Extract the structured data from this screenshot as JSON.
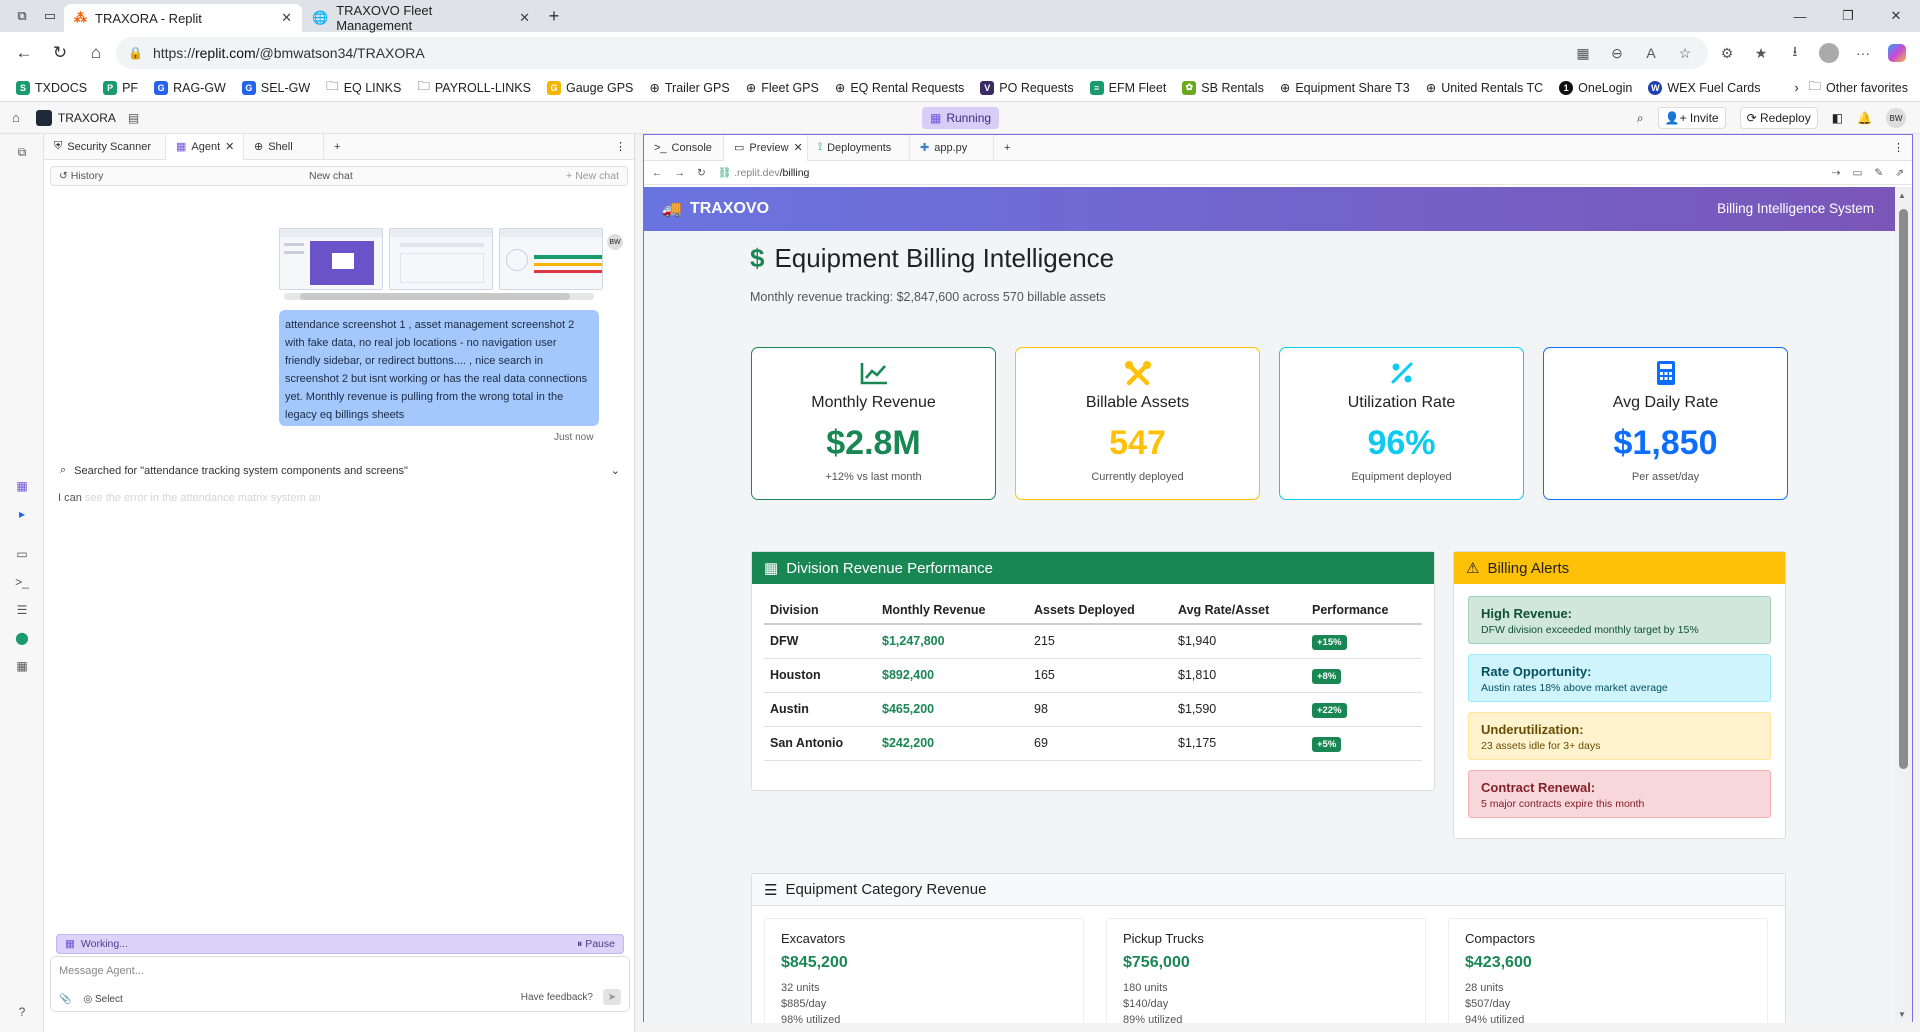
{
  "browser": {
    "tabs": [
      {
        "title": "TRAXORA - Replit",
        "active": true
      },
      {
        "title": "TRAXOVO Fleet Management",
        "active": false
      }
    ],
    "url_prefix": "https://",
    "url_host": "replit.com",
    "url_path": "/@bmwatson34/TRAXORA",
    "favorites": [
      "TXDOCS",
      "PF",
      "RAG-GW",
      "SEL-GW",
      "EQ LINKS",
      "PAYROLL-LINKS",
      "Gauge GPS",
      "Trailer GPS",
      "Fleet GPS",
      "EQ Rental Requests",
      "PO Requests",
      "EFM Fleet",
      "SB Rentals",
      "Equipment Share T3",
      "United Rentals TC",
      "OneLogin",
      "WEX Fuel Cards"
    ],
    "other_favorites": "Other favorites"
  },
  "replit": {
    "project": "TRAXORA",
    "status": "Running",
    "invite": "Invite",
    "redeploy": "Redeploy",
    "avatar": "BW",
    "left_tabs": [
      "Security Scanner",
      "Agent",
      "Shell"
    ],
    "history": "History",
    "new_chat_center": "New chat",
    "new_chat_right": "+ New chat",
    "message": "attendance screenshot 1 , asset management screenshot 2 with fake data, no real job locations - no navigation user friendly sidebar, or redirect buttons.... , nice search in screenshot 2 but isnt working or has the real data connections yet. Monthly revenue is pulling from the wrong total in the legacy eq billings sheets",
    "timestamp": "Just now",
    "searched": "Searched for \"attendance tracking system components and screens\"",
    "streaming_prefix": "I can",
    "streaming_faded": "see the error in the attendance matrix system an",
    "working": "Working...",
    "pause": "Pause",
    "message_placeholder": "Message Agent...",
    "select": "Select",
    "feedback": "Have feedback?",
    "right_tabs": [
      "Console",
      "Preview",
      "Deployments",
      "app.py"
    ],
    "preview_url_host": ".replit.dev",
    "preview_url_path": "/billing",
    "help": "?"
  },
  "app": {
    "brand": "TRAXOVO",
    "header_right": "Billing Intelligence System",
    "title": "Equipment Billing Intelligence",
    "subtitle": "Monthly revenue tracking: $2,847,600 across 570 billable assets",
    "kpis": [
      {
        "label": "Monthly Revenue",
        "value": "$2.8M",
        "sub": "+12% vs last month",
        "color": "#198754",
        "icon": "chart-line-icon"
      },
      {
        "label": "Billable Assets",
        "value": "547",
        "sub": "Currently deployed",
        "color": "#ffc107",
        "icon": "tools-icon"
      },
      {
        "label": "Utilization Rate",
        "value": "96%",
        "sub": "Equipment deployed",
        "color": "#0dcaf0",
        "icon": "percent-icon"
      },
      {
        "label": "Avg Daily Rate",
        "value": "$1,850",
        "sub": "Per asset/day",
        "color": "#0d6efd",
        "icon": "calculator-icon"
      }
    ],
    "division": {
      "title": "Division Revenue Performance",
      "headers": [
        "Division",
        "Monthly Revenue",
        "Assets Deployed",
        "Avg Rate/Asset",
        "Performance"
      ],
      "rows": [
        [
          "DFW",
          "$1,247,800",
          "215",
          "$1,940",
          "+15%"
        ],
        [
          "Houston",
          "$892,400",
          "165",
          "$1,810",
          "+8%"
        ],
        [
          "Austin",
          "$465,200",
          "98",
          "$1,590",
          "+22%"
        ],
        [
          "San Antonio",
          "$242,200",
          "69",
          "$1,175",
          "+5%"
        ]
      ]
    },
    "alerts": {
      "title": "Billing Alerts",
      "items": [
        {
          "title": "High Revenue:",
          "desc": "DFW division exceeded monthly target by 15%",
          "bg": "#d1e7dd",
          "border": "#a3cfbb",
          "fg": "#0f5132"
        },
        {
          "title": "Rate Opportunity:",
          "desc": "Austin rates 18% above market average",
          "bg": "#cff4fc",
          "border": "#9eeaf9",
          "fg": "#055160"
        },
        {
          "title": "Underutilization:",
          "desc": "23 assets idle for 3+ days",
          "bg": "#fff3cd",
          "border": "#ffe69c",
          "fg": "#664d03"
        },
        {
          "title": "Contract Renewal:",
          "desc": "5 major contracts expire this month",
          "bg": "#f8d7da",
          "border": "#f1aeb5",
          "fg": "#842029"
        }
      ]
    },
    "categories": {
      "title": "Equipment Category Revenue",
      "items": [
        {
          "name": "Excavators",
          "revenue": "$845,200",
          "units": "32 units",
          "rate": "$885/day",
          "util": "98% utilized"
        },
        {
          "name": "Pickup Trucks",
          "revenue": "$756,000",
          "units": "180 units",
          "rate": "$140/day",
          "util": "89% utilized"
        },
        {
          "name": "Compactors",
          "revenue": "$423,600",
          "units": "28 units",
          "rate": "$507/day",
          "util": "94% utilized"
        }
      ]
    }
  }
}
